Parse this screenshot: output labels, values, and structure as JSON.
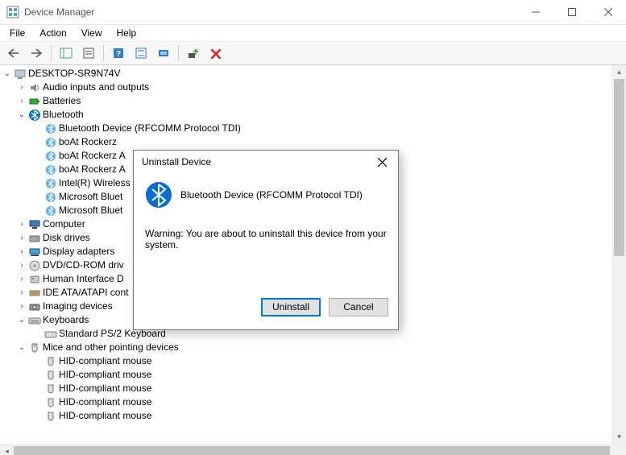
{
  "window": {
    "title": "Device Manager"
  },
  "menu": {
    "file": "File",
    "action": "Action",
    "view": "View",
    "help": "Help"
  },
  "root": {
    "name": "DESKTOP-SR9N74V"
  },
  "tree": {
    "audio": "Audio inputs and outputs",
    "batteries": "Batteries",
    "bluetooth": "Bluetooth",
    "bt0": "Bluetooth Device (RFCOMM Protocol TDI)",
    "bt1": "boAt Rockerz",
    "bt2": "boAt Rockerz A",
    "bt3": "boAt Rockerz A",
    "bt4": "Intel(R) Wireless",
    "bt5": "Microsoft Bluet",
    "bt6": "Microsoft Bluet",
    "computer": "Computer",
    "disks": "Disk drives",
    "display": "Display adapters",
    "dvd": "DVD/CD-ROM driv",
    "hid": "Human Interface D",
    "ide": "IDE ATA/ATAPI cont",
    "imaging": "Imaging devices",
    "keyboards": "Keyboards",
    "kb0": "Standard PS/2 Keyboard",
    "mice": "Mice and other pointing devices",
    "m0": "HID-compliant mouse",
    "m1": "HID-compliant mouse",
    "m2": "HID-compliant mouse",
    "m3": "HID-compliant mouse",
    "m4": "HID-compliant mouse"
  },
  "dialog": {
    "title": "Uninstall Device",
    "device": "Bluetooth Device (RFCOMM Protocol TDI)",
    "warning": "Warning: You are about to uninstall this device from your system.",
    "uninstall": "Uninstall",
    "cancel": "Cancel"
  }
}
